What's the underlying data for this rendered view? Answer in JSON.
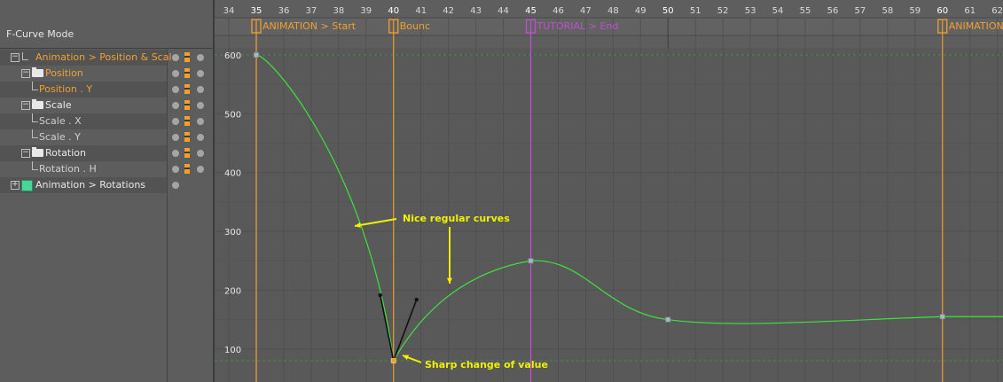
{
  "panel": {
    "mode_title": "F-Curve Mode"
  },
  "tree": [
    {
      "label": "Animation > Position & Scale",
      "color": "orange",
      "indent": 0,
      "icon": "null-object-icon",
      "expander": "−"
    },
    {
      "label": "Position",
      "color": "orange",
      "indent": 1,
      "icon": "folder-icon",
      "expander": "−"
    },
    {
      "label": "Position . Y",
      "color": "orange",
      "indent": 2,
      "icon": "branch",
      "expander": ""
    },
    {
      "label": "Scale",
      "color": "normal",
      "indent": 1,
      "icon": "folder-icon",
      "expander": "−"
    },
    {
      "label": "Scale . X",
      "color": "dim",
      "indent": 2,
      "icon": "branch",
      "expander": ""
    },
    {
      "label": "Scale . Y",
      "color": "dim",
      "indent": 2,
      "icon": "branch",
      "expander": ""
    },
    {
      "label": "Rotation",
      "color": "normal",
      "indent": 1,
      "icon": "folder-icon",
      "expander": "−"
    },
    {
      "label": "Rotation . H",
      "color": "dim",
      "indent": 2,
      "icon": "branch",
      "expander": ""
    },
    {
      "label": "Animation > Rotations",
      "color": "normal",
      "indent": 0,
      "icon": "object-icon",
      "expander": "+"
    }
  ],
  "timeline": {
    "frames": [
      "34",
      "35",
      "36",
      "37",
      "38",
      "39",
      "40",
      "41",
      "42",
      "43",
      "44",
      "45",
      "46",
      "47",
      "48",
      "49",
      "50",
      "51",
      "52",
      "53",
      "54",
      "55",
      "56",
      "57",
      "58",
      "59",
      "60",
      "61",
      "62"
    ],
    "highlighted_frames": [
      "35",
      "40",
      "45",
      "50",
      "60"
    ],
    "markers": [
      {
        "label": "ANIMATION > Start",
        "frame": 35,
        "color": "#f0a030"
      },
      {
        "label": "Bounc",
        "frame": 40,
        "color": "#f0a030"
      },
      {
        "label": "TUTORIAL > End",
        "frame": 45,
        "color": "#c050d0"
      },
      {
        "label": "ANIMATION",
        "frame": 60,
        "color": "#f0a030"
      }
    ]
  },
  "y_axis": {
    "labels": [
      "600",
      "500",
      "400",
      "300",
      "200",
      "100"
    ]
  },
  "curve": {
    "color": "#40e040",
    "keyframes": [
      {
        "frame": 35,
        "value": 600
      },
      {
        "frame": 40,
        "value": 80
      },
      {
        "frame": 45,
        "value": 250
      },
      {
        "frame": 50,
        "value": 150
      },
      {
        "frame": 60,
        "value": 155
      }
    ]
  },
  "annotations": {
    "nice_curves": "Nice regular curves",
    "sharp_change": "Sharp change of value",
    "color": "#f2f200"
  }
}
